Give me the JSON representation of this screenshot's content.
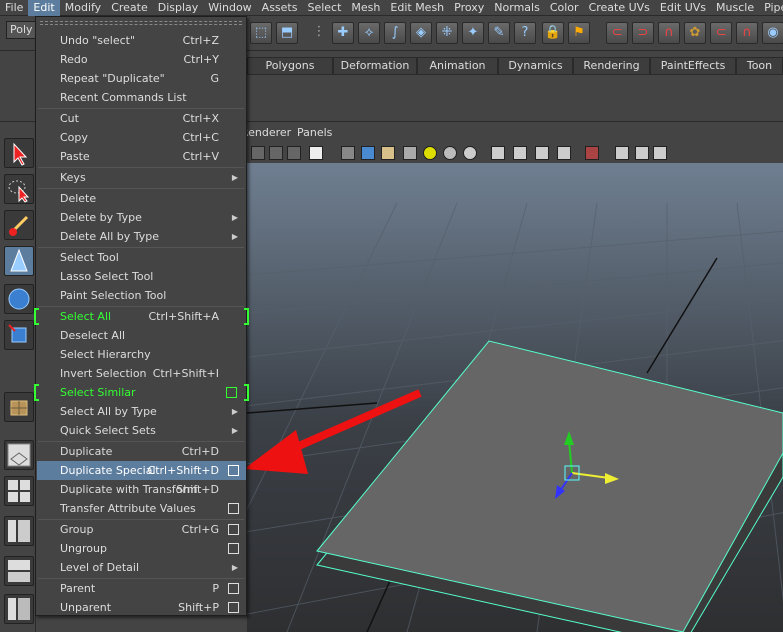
{
  "menubar": {
    "items": [
      "File",
      "Edit",
      "Modify",
      "Create",
      "Display",
      "Window",
      "Assets",
      "Select",
      "Mesh",
      "Edit Mesh",
      "Proxy",
      "Normals",
      "Color",
      "Create UVs",
      "Edit UVs",
      "Muscle",
      "Pipe"
    ],
    "active_index": 1
  },
  "status": {
    "mode_label": "Poly"
  },
  "shelf": {
    "tabs": [
      "Polygons",
      "Deformation",
      "Animation",
      "Dynamics",
      "Rendering",
      "PaintEffects",
      "Toon"
    ]
  },
  "panel_menu": {
    "renderer": "Renderer",
    "panels": "Panels"
  },
  "edit_menu": {
    "items": [
      {
        "label": "Undo \"select\"",
        "shortcut": "Ctrl+Z"
      },
      {
        "label": "Redo",
        "shortcut": "Ctrl+Y"
      },
      {
        "label": "Repeat \"Duplicate\"",
        "shortcut": "G"
      },
      {
        "label": "Recent Commands List",
        "shortcut": ""
      },
      {
        "label": "Cut",
        "shortcut": "Ctrl+X"
      },
      {
        "label": "Copy",
        "shortcut": "Ctrl+C"
      },
      {
        "label": "Paste",
        "shortcut": "Ctrl+V"
      },
      {
        "label": "Keys",
        "shortcut": ""
      },
      {
        "label": "Delete",
        "shortcut": ""
      },
      {
        "label": "Delete by Type",
        "shortcut": ""
      },
      {
        "label": "Delete All by Type",
        "shortcut": ""
      },
      {
        "label": "Select Tool",
        "shortcut": ""
      },
      {
        "label": "Lasso Select Tool",
        "shortcut": ""
      },
      {
        "label": "Paint Selection Tool",
        "shortcut": ""
      },
      {
        "label": "Select All",
        "shortcut": "Ctrl+Shift+A"
      },
      {
        "label": "Deselect All",
        "shortcut": ""
      },
      {
        "label": "Select Hierarchy",
        "shortcut": ""
      },
      {
        "label": "Invert Selection",
        "shortcut": "Ctrl+Shift+I"
      },
      {
        "label": "Select Similar",
        "shortcut": ""
      },
      {
        "label": "Select All by Type",
        "shortcut": ""
      },
      {
        "label": "Quick Select Sets",
        "shortcut": ""
      },
      {
        "label": "Duplicate",
        "shortcut": "Ctrl+D"
      },
      {
        "label": "Duplicate Special",
        "shortcut": "Ctrl+Shift+D"
      },
      {
        "label": "Duplicate with Transform",
        "shortcut": "Shift+D"
      },
      {
        "label": "Transfer Attribute Values",
        "shortcut": ""
      },
      {
        "label": "Group",
        "shortcut": "Ctrl+G"
      },
      {
        "label": "Ungroup",
        "shortcut": ""
      },
      {
        "label": "Level of Detail",
        "shortcut": ""
      },
      {
        "label": "Parent",
        "shortcut": "P"
      },
      {
        "label": "Unparent",
        "shortcut": "Shift+P"
      }
    ]
  },
  "colors": {
    "highlight": "#5d7d9e",
    "hotkey_green": "#33ff33",
    "arrow_red": "#ee1111",
    "mesh_outline": "#55ffcc"
  }
}
